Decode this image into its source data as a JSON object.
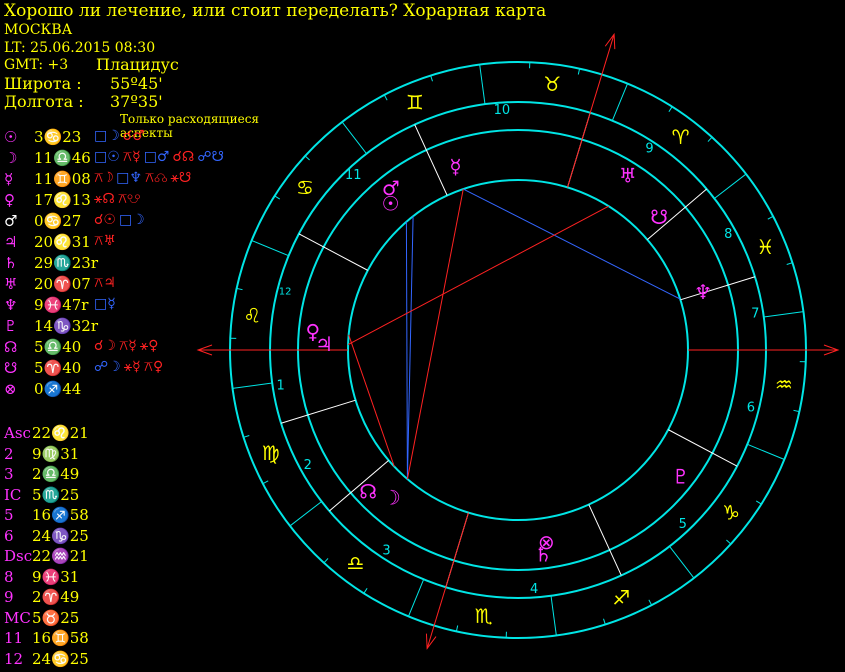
{
  "header": {
    "title": "Хорошо ли лечение, или стоит переделать? Хорарная карта",
    "city": "МОСКВА",
    "lt": "LT: 25.06.2015  08:30",
    "gmt": "GMT: +3",
    "system": "Плацидус",
    "lat_label": "Широта :",
    "lat_value": "55º45'",
    "lon_label": "Долгота :",
    "lon_value": "37º35'",
    "aspects_title": "Только расходящиеся аспекты"
  },
  "planets": [
    {
      "glyph": "☉",
      "pos": "3♋23",
      "color": "#ff33ff",
      "aspects": [
        {
          "t": "□☽",
          "c": "#3366ff"
        },
        {
          "t": "☌♂",
          "c": "#ff2222"
        }
      ]
    },
    {
      "glyph": "☽",
      "pos": "11♎46",
      "color": "#ff33ff",
      "aspects": [
        {
          "t": "□☉",
          "c": "#3366ff"
        },
        {
          "t": "⚻☿",
          "c": "#ff2222"
        },
        {
          "t": "□♂",
          "c": "#3366ff"
        },
        {
          "t": "☌☊",
          "c": "#ff2222"
        },
        {
          "t": "☍☋",
          "c": "#3366ff"
        }
      ]
    },
    {
      "glyph": "☿",
      "pos": "11♊08",
      "color": "#ff33ff",
      "aspects": [
        {
          "t": "⚻☽",
          "c": "#ff2222"
        },
        {
          "t": "□♆",
          "c": "#3366ff"
        },
        {
          "t": "⚻☊",
          "c": "#ff2222"
        },
        {
          "t": "⚹☋",
          "c": "#ff2222"
        }
      ]
    },
    {
      "glyph": "♀",
      "pos": "17♌13",
      "color": "#ff33ff",
      "aspects": [
        {
          "t": "⚹☊",
          "c": "#ff2222"
        },
        {
          "t": "⚻☋",
          "c": "#ff2222"
        }
      ]
    },
    {
      "glyph": "♂",
      "pos": "0♋27",
      "color": "#ffffff",
      "aspects": [
        {
          "t": "☌☉",
          "c": "#ff2222"
        },
        {
          "t": "□☽",
          "c": "#3366ff"
        }
      ]
    },
    {
      "glyph": "♃",
      "pos": "20♌31",
      "color": "#ff33ff",
      "aspects": [
        {
          "t": "⚻♅",
          "c": "#ff2222"
        }
      ]
    },
    {
      "glyph": "♄",
      "pos": "29♏23r",
      "color": "#ff33ff",
      "aspects": []
    },
    {
      "glyph": "♅",
      "pos": "20♈07",
      "color": "#ff33ff",
      "aspects": [
        {
          "t": "⚻♃",
          "c": "#ff2222"
        }
      ]
    },
    {
      "glyph": "♆",
      "pos": "9♓47r",
      "color": "#ff33ff",
      "aspects": [
        {
          "t": "□☿",
          "c": "#3366ff"
        }
      ]
    },
    {
      "glyph": "♇",
      "pos": "14♑32r",
      "color": "#ff33ff",
      "aspects": []
    },
    {
      "glyph": "☊",
      "pos": "5♎40",
      "color": "#ff33ff",
      "aspects": [
        {
          "t": "☌☽",
          "c": "#ff2222"
        },
        {
          "t": "⚻☿",
          "c": "#ff2222"
        },
        {
          "t": "⚹♀",
          "c": "#ff2222"
        }
      ]
    },
    {
      "glyph": "☋",
      "pos": "5♈40",
      "color": "#ff33ff",
      "aspects": [
        {
          "t": "☍☽",
          "c": "#3366ff"
        },
        {
          "t": "⚹☿",
          "c": "#ff2222"
        },
        {
          "t": "⚻♀",
          "c": "#ff2222"
        }
      ]
    },
    {
      "glyph": "⊗",
      "pos": "0♐44",
      "color": "#ff33ff",
      "aspects": []
    }
  ],
  "cusps": [
    {
      "label": "Asc",
      "value": "22♌21"
    },
    {
      "label": "2",
      "value": "9♍31"
    },
    {
      "label": "3",
      "value": "2♎49"
    },
    {
      "label": "IC",
      "value": "5♏25"
    },
    {
      "label": "5",
      "value": "16♐58"
    },
    {
      "label": "6",
      "value": "24♑25"
    },
    {
      "label": "Dsc",
      "value": "22♒21"
    },
    {
      "label": "8",
      "value": "9♓31"
    },
    {
      "label": "9",
      "value": "2♈49"
    },
    {
      "label": "MC",
      "value": "5♉25"
    },
    {
      "label": "11",
      "value": "16♊58"
    },
    {
      "label": "12",
      "value": "24♋25"
    }
  ],
  "wheel": {
    "asc_deg": 142.35,
    "mc_deg": 35.42,
    "signs": [
      "♈",
      "♉",
      "♊",
      "♋",
      "♌",
      "♍",
      "♎",
      "♏",
      "♐",
      "♑",
      "♒",
      "♓"
    ],
    "sign_color": "#ffff00",
    "ring_color": "#00e5e5",
    "house_cusps_deg": [
      142.35,
      159.52,
      182.82,
      215.42,
      256.97,
      294.42,
      322.35,
      339.52,
      2.82,
      35.42,
      76.97,
      114.42
    ],
    "house_numbers": [
      "1",
      "2",
      "3",
      "4",
      "5",
      "6",
      "7",
      "8",
      "9",
      "10",
      "11",
      "12"
    ],
    "bodies": [
      {
        "glyph": "☉",
        "deg": 93.38,
        "color": "#ff33ff"
      },
      {
        "glyph": "♂",
        "deg": 90.45,
        "color": "#ff33ff"
      },
      {
        "glyph": "☽",
        "deg": 191.77,
        "color": "#ff33ff"
      },
      {
        "glyph": "☊",
        "deg": 185.67,
        "color": "#ff33ff"
      },
      {
        "glyph": "☿",
        "deg": 71.13,
        "color": "#ff33ff"
      },
      {
        "glyph": "♀",
        "deg": 137.22,
        "color": "#ff33ff"
      },
      {
        "glyph": "♃",
        "deg": 140.52,
        "color": "#ff33ff"
      },
      {
        "glyph": "♄",
        "deg": 239.38,
        "color": "#ff33ff"
      },
      {
        "glyph": "⊗",
        "deg": 240.73,
        "color": "#ff33ff"
      },
      {
        "glyph": "♇",
        "deg": 284.53,
        "color": "#ff33ff"
      },
      {
        "glyph": "♆",
        "deg": 339.78,
        "color": "#ff33ff"
      },
      {
        "glyph": "♅",
        "deg": 20.12,
        "color": "#ff33ff"
      },
      {
        "glyph": "☋",
        "deg": 5.67,
        "color": "#ff33ff"
      }
    ],
    "aspect_lines": [
      {
        "from": 93.38,
        "to": 191.77,
        "color": "#3366ff"
      },
      {
        "from": 90.45,
        "to": 191.77,
        "color": "#3366ff"
      },
      {
        "from": 71.13,
        "to": 339.78,
        "color": "#3366ff"
      },
      {
        "from": 71.13,
        "to": 191.77,
        "color": "#ff2222"
      },
      {
        "from": 140.52,
        "to": 20.12,
        "color": "#ff2222"
      },
      {
        "from": 137.22,
        "to": 185.67,
        "color": "#ff2222"
      }
    ]
  }
}
